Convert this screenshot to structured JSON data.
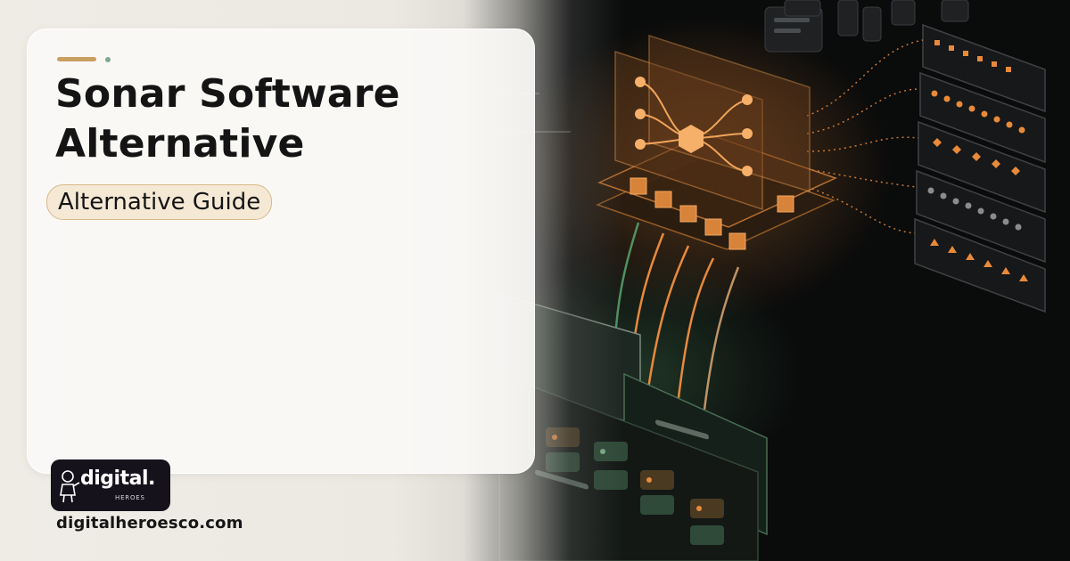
{
  "hero": {
    "title_line1": "Sonar Software",
    "title_line2": "Alternative",
    "tag": "Alternative Guide"
  },
  "brand": {
    "logo_word": "digital.",
    "logo_sub": "HEROES",
    "website": "digitalheroesco.com"
  },
  "colors": {
    "accent": "#c9a061",
    "accent_dot": "#7fa88c",
    "glow_orange": "#e98a3a",
    "glow_green": "#5fae74",
    "pill_fill": "#f5e9d6",
    "pill_border": "#d8b98a",
    "logo_bg": "#16121c"
  },
  "icons": {
    "logo_mascot": "hero-mascot-icon"
  }
}
